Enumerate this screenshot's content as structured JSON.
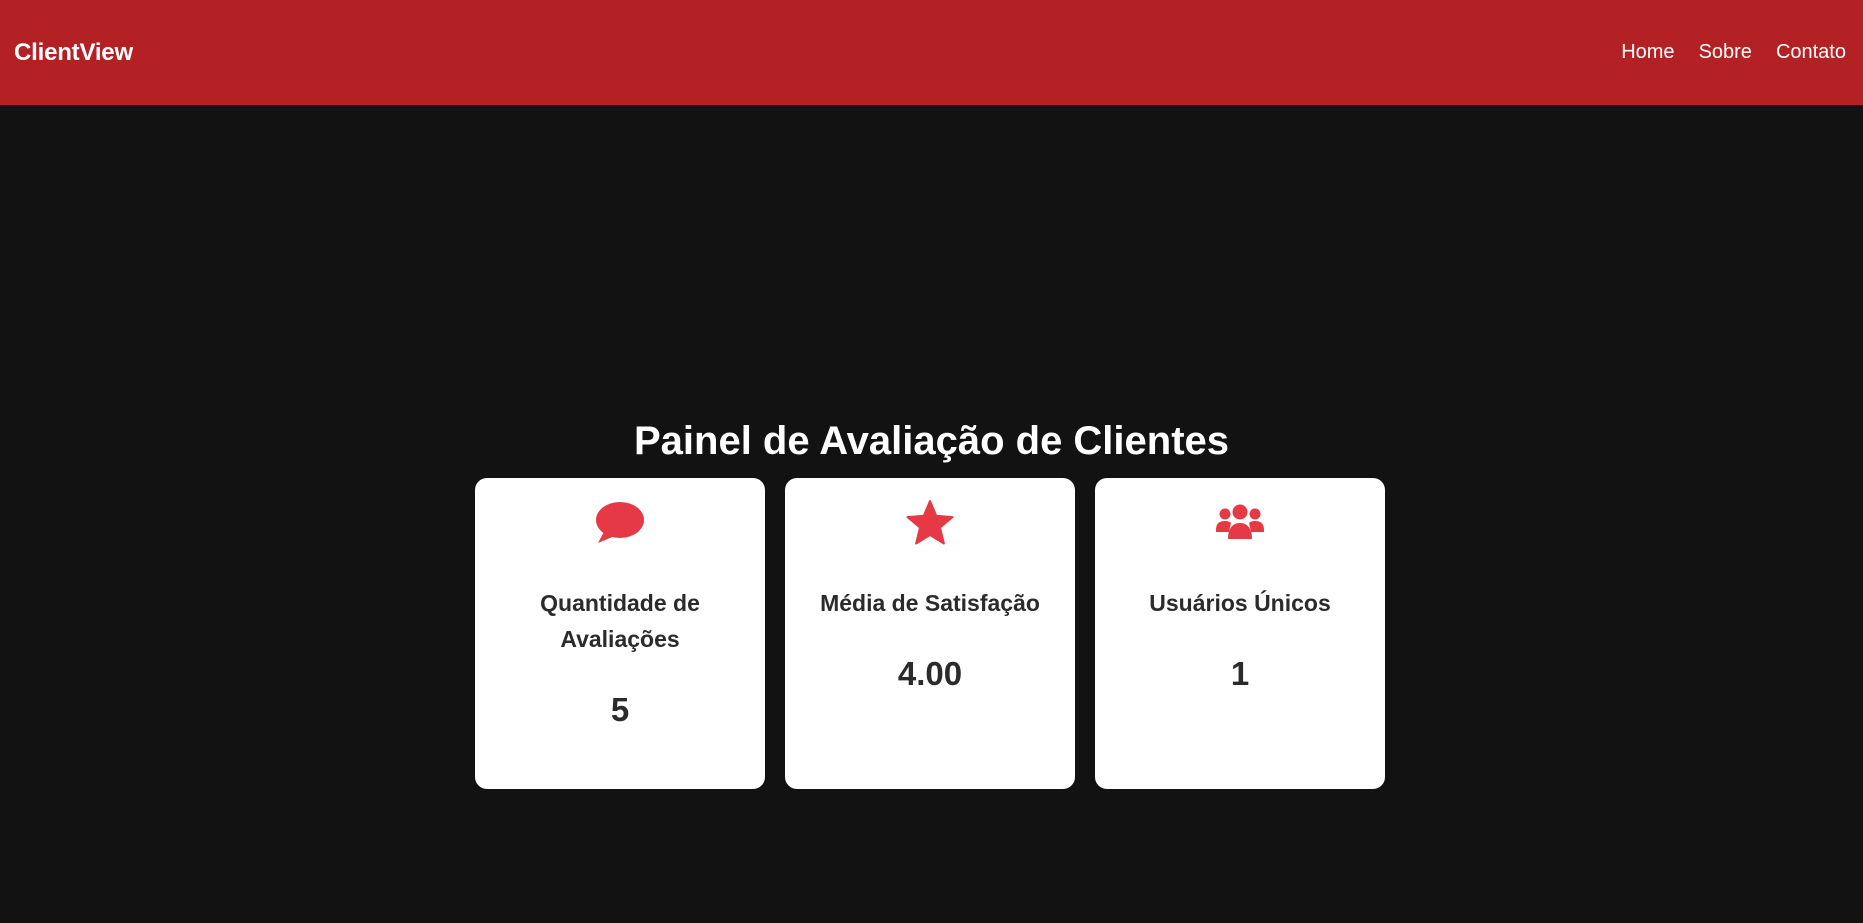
{
  "header": {
    "brand": "ClientView",
    "nav": [
      {
        "label": "Home"
      },
      {
        "label": "Sobre"
      },
      {
        "label": "Contato"
      }
    ]
  },
  "main": {
    "title": "Painel de Avaliação de Clientes",
    "cards": [
      {
        "icon": "speech-bubble-icon",
        "label": "Quantidade de Avaliações",
        "value": "5"
      },
      {
        "icon": "star-icon",
        "label": "Média de Satisfação",
        "value": "4.00"
      },
      {
        "icon": "users-icon",
        "label": "Usuários Únicos",
        "value": "1"
      }
    ]
  },
  "colors": {
    "header_background": "#b32124",
    "page_background": "#121212",
    "card_background": "#ffffff",
    "icon_accent": "#e53946",
    "card_text": "#2b2b2b"
  }
}
